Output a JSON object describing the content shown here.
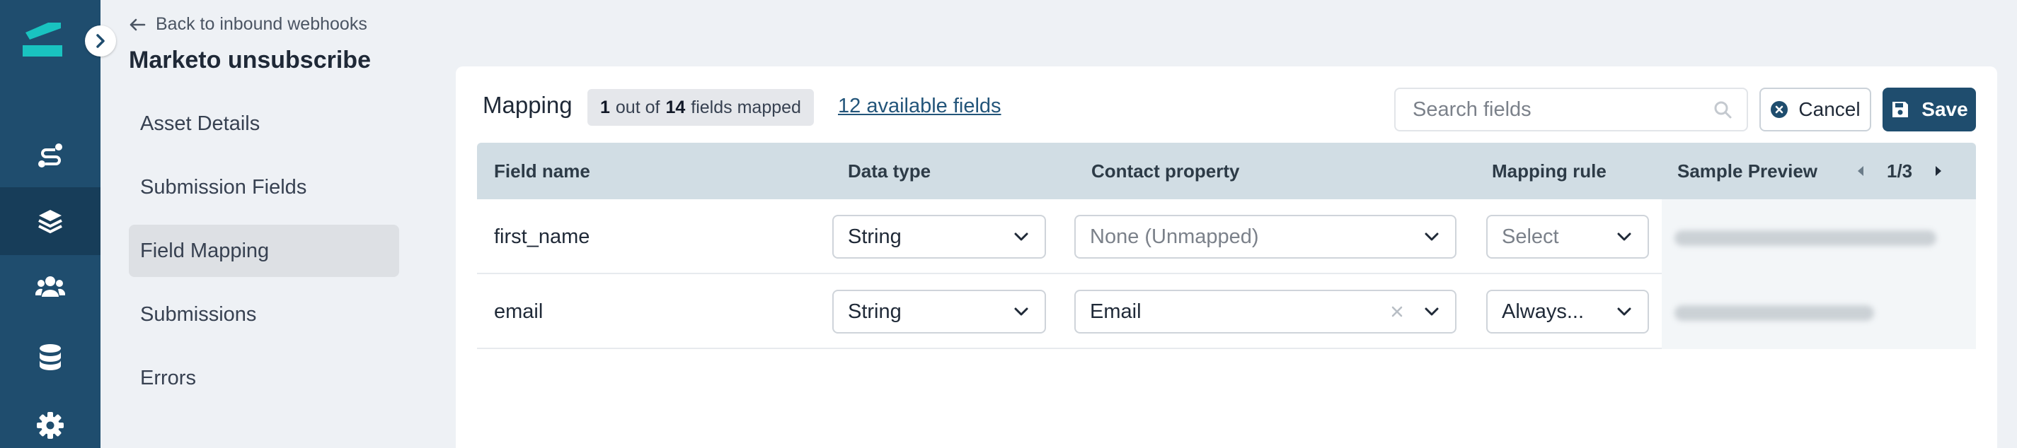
{
  "nav": {
    "back_label": "Back to inbound webhooks",
    "page_title": "Marketo unsubscribe",
    "items": [
      {
        "label": "Asset Details"
      },
      {
        "label": "Submission Fields"
      },
      {
        "label": "Field Mapping"
      },
      {
        "label": "Submissions"
      },
      {
        "label": "Errors"
      }
    ],
    "active_index": 2
  },
  "rail": {
    "icons": [
      "logo-icon",
      "journey-icon",
      "layers-icon",
      "users-icon",
      "database-icon",
      "gear-icon"
    ],
    "active": "layers-icon"
  },
  "mapping": {
    "title": "Mapping",
    "badge": {
      "mapped": "1",
      "out_of": "out of",
      "total": "14",
      "suffix": "fields mapped"
    },
    "available_link": "12 available fields",
    "search_placeholder": "Search fields",
    "cancel_label": "Cancel",
    "save_label": "Save"
  },
  "table": {
    "columns": [
      "Field name",
      "Data type",
      "Contact property",
      "Mapping rule",
      "Sample Preview"
    ],
    "pager": "1/3",
    "rows": [
      {
        "field_name": "first_name",
        "data_type": "String",
        "contact_property": "None (Unmapped)",
        "contact_property_placeholder": true,
        "mapping_rule": "Select",
        "mapping_rule_placeholder": true
      },
      {
        "field_name": "email",
        "data_type": "String",
        "contact_property": "Email",
        "contact_property_placeholder": false,
        "mapping_rule": "Always...",
        "mapping_rule_placeholder": false
      }
    ]
  },
  "colors": {
    "rail_bg": "#1f4d6e",
    "rail_active": "#173d59",
    "accent": "#23557a",
    "logo": "#19c3c0",
    "table_header": "#d1dde4"
  }
}
